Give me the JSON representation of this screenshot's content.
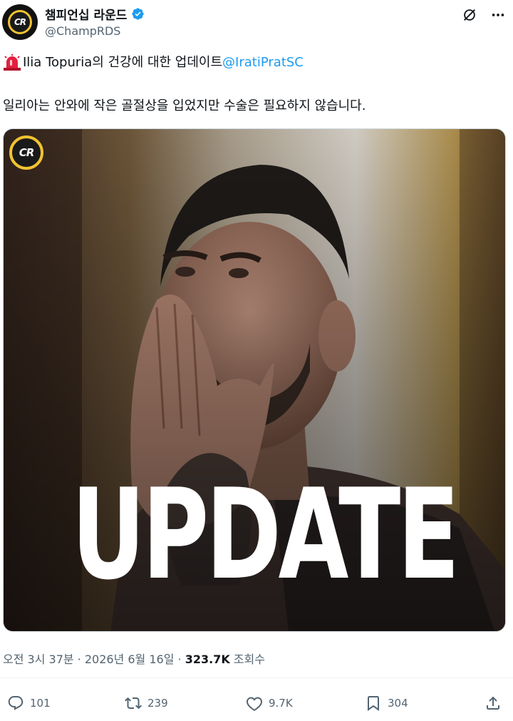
{
  "account": {
    "display_name": "챔피언십 라운드",
    "handle": "@ChampRDS",
    "avatar_text": "CR"
  },
  "tweet": {
    "line1_text": "Ilia Topuria의 건강에 대한 업데이트",
    "mention": "@IratiPratSC",
    "line2_text": "일리아는 안와에 작은 골절상을 입었지만 수술은 필요하지 않습니다."
  },
  "media": {
    "badge_text": "CR",
    "overlay_text": "UPDATE"
  },
  "meta": {
    "timestamp": "오전 3시 37분 · 2026년 6월 16일 · ",
    "views": "323.7K",
    "views_label": " 조회수"
  },
  "actions": {
    "replies": "101",
    "reposts": "239",
    "likes": "9.7K",
    "bookmarks": "304"
  },
  "colors": {
    "accent": "#1d9bf0",
    "verified": "#1d9bf0",
    "badge_ring": "#f2c230"
  },
  "icons": [
    "verified-badge-icon",
    "grok-icon",
    "more-icon",
    "siren-emoji-icon",
    "reply-icon",
    "repost-icon",
    "like-icon",
    "bookmark-icon",
    "share-icon"
  ]
}
